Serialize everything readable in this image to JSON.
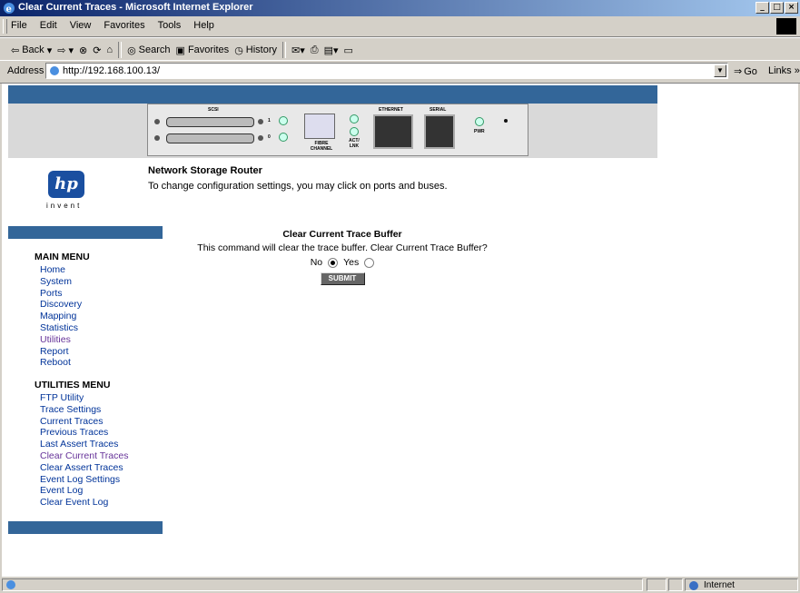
{
  "window": {
    "title": "Clear Current Traces - Microsoft Internet Explorer"
  },
  "menubar": {
    "items": [
      "File",
      "Edit",
      "View",
      "Favorites",
      "Tools",
      "Help"
    ]
  },
  "toolbar": {
    "back": "Back",
    "search": "Search",
    "favorites": "Favorites",
    "history": "History"
  },
  "address": {
    "label": "Address",
    "url": "http://192.168.100.13/",
    "go": "Go",
    "links": "Links »"
  },
  "device": {
    "scsi": "SCSI",
    "fibre": "FIBRE CHANNEL",
    "actlnk": "ACT/ LNK",
    "ethernet": "ETHERNET",
    "serial": "SERIAL",
    "pwr": "PWR",
    "port1": "1",
    "port0": "0"
  },
  "logo": {
    "mark": "hp",
    "tagline": "invent"
  },
  "header": {
    "title": "Network Storage Router",
    "subtitle": "To change configuration settings, you may click on ports and buses."
  },
  "main_menu": {
    "heading": "MAIN MENU",
    "items": [
      "Home",
      "System",
      "Ports",
      "Discovery",
      "Mapping",
      "Statistics",
      "Utilities",
      "Report",
      "Reboot"
    ],
    "active_item": "Utilities"
  },
  "utilities_menu": {
    "heading": "UTILITIES MENU",
    "items": [
      "FTP Utility",
      "Trace Settings",
      "Current Traces",
      "Previous Traces",
      "Last Assert Traces",
      "Clear Current Traces",
      "Clear Assert Traces",
      "Event Log Settings",
      "Event Log",
      "Clear Event Log"
    ],
    "active_item": "Clear Current Traces"
  },
  "content": {
    "title": "Clear Current Trace Buffer",
    "description": "This command will clear the trace buffer. Clear Current Trace Buffer?",
    "option_no": "No",
    "option_yes": "Yes",
    "selected": "No",
    "submit": "SUBMIT"
  },
  "status": {
    "zone": "Internet"
  },
  "colors": {
    "band": "#336699",
    "link": "#003399",
    "visited": "#663399"
  }
}
